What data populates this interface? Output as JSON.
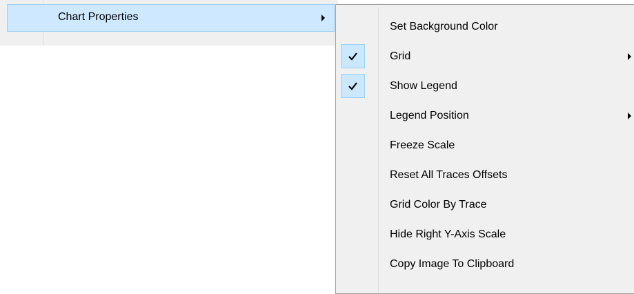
{
  "parent_menu": {
    "item_label": "Chart Properties"
  },
  "submenu": {
    "items": [
      {
        "label": "Set Background Color",
        "checked": false,
        "has_submenu": false
      },
      {
        "label": "Grid",
        "checked": true,
        "has_submenu": true
      },
      {
        "label": "Show Legend",
        "checked": true,
        "has_submenu": false
      },
      {
        "label": "Legend Position",
        "checked": false,
        "has_submenu": true
      },
      {
        "label": "Freeze Scale",
        "checked": false,
        "has_submenu": false
      },
      {
        "label": "Reset All Traces Offsets",
        "checked": false,
        "has_submenu": false
      },
      {
        "label": "Grid Color By Trace",
        "checked": false,
        "has_submenu": false
      },
      {
        "label": "Hide Right Y-Axis Scale",
        "checked": false,
        "has_submenu": false
      },
      {
        "label": "Copy Image To Clipboard",
        "checked": false,
        "has_submenu": false
      }
    ]
  },
  "colors": {
    "menu_bg": "#f0f0f0",
    "highlight_bg": "#cde8ff",
    "highlight_border": "#99d1ff"
  }
}
